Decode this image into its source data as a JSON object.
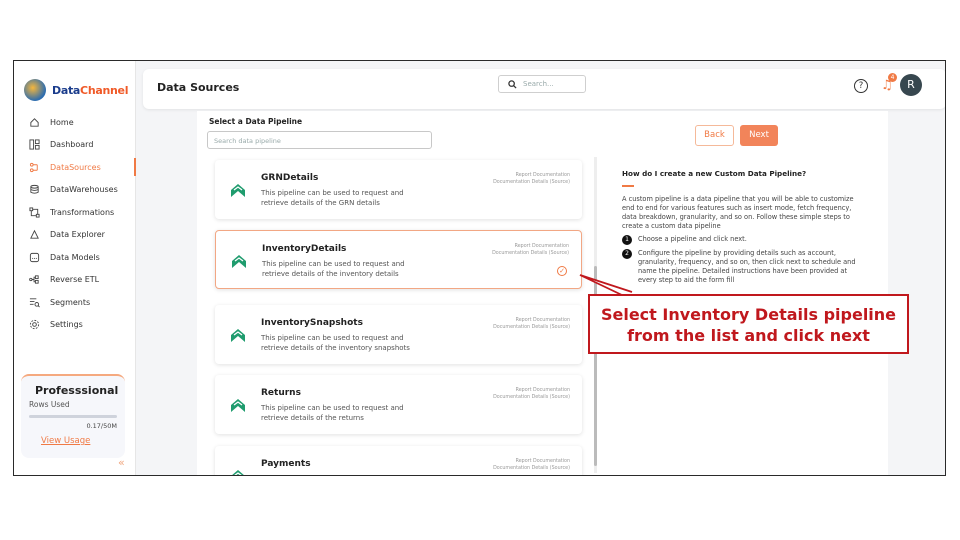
{
  "app": {
    "brand_part1": "Data",
    "brand_part2": "Channel"
  },
  "header": {
    "title": "Data Sources",
    "search_placeholder": "Search...",
    "help": "?",
    "notifications": "4",
    "avatar": "R"
  },
  "sidebar": {
    "items": [
      {
        "label": "Home",
        "icon": "home-icon"
      },
      {
        "label": "Dashboard",
        "icon": "dashboard-icon"
      },
      {
        "label": "DataSources",
        "icon": "datasources-icon",
        "active": true
      },
      {
        "label": "DataWarehouses",
        "icon": "database-icon"
      },
      {
        "label": "Transformations",
        "icon": "transform-icon"
      },
      {
        "label": "Data Explorer",
        "icon": "explorer-icon"
      },
      {
        "label": "Data Models",
        "icon": "models-icon"
      },
      {
        "label": "Reverse ETL",
        "icon": "reverse-etl-icon"
      },
      {
        "label": "Segments",
        "icon": "segments-icon"
      },
      {
        "label": "Settings",
        "icon": "settings-icon"
      }
    ],
    "plan": {
      "title": "Professsional",
      "rows_label": "Rows Used",
      "rows_value": "0.17/50M",
      "usage_link": "View Usage",
      "usage_fraction": 0.0034
    }
  },
  "main": {
    "select_label": "Select a Data Pipeline",
    "search_placeholder": "Search data pipeline",
    "back": "Back",
    "next": "Next",
    "pipelines": [
      {
        "name": "GRNDetails",
        "desc": "This pipeline can be used to request and retrieve details of the GRN details",
        "doc1": "Report Documentation",
        "doc2": "Documentation Details (Source)"
      },
      {
        "name": "InventoryDetails",
        "desc": "This pipeline can be used to request and retrieve details of the inventory details",
        "doc1": "Report Documentation",
        "doc2": "Documentation Details (Source)",
        "selected": true
      },
      {
        "name": "InventorySnapshots",
        "desc": "This pipeline can be used to request and retrieve details of the inventory snapshots",
        "doc1": "Report Documentation",
        "doc2": "Documentation Details (Source)"
      },
      {
        "name": "Returns",
        "desc": "This pipeline can be used to request and retrieve details of the returns",
        "doc1": "Report Documentation",
        "doc2": "Documentation Details (Source)"
      },
      {
        "name": "Payments",
        "desc": "",
        "doc1": "Report Documentation",
        "doc2": "Documentation Details (Source)"
      }
    ],
    "help": {
      "title": "How do I create a new Custom Data Pipeline?",
      "text": "A custom pipeline is a data pipeline that you will be able to customize end to end for various features such as insert mode, fetch frequency, data breakdown, granularity, and so on. Follow these simple steps to create a custom data pipeline",
      "steps": [
        {
          "num": "1",
          "text": "Choose a pipeline and click next."
        },
        {
          "num": "2",
          "text": "Configure the pipeline by providing details such as account, granularity, frequency, and so on, then click next to schedule and name the pipeline. Detailed instructions have been provided at every step to aid the form fill"
        }
      ]
    }
  },
  "callout": {
    "text": "Select Inventory Details pipeline from the list and click next"
  },
  "colors": {
    "accent": "#f07a45",
    "callout": "#c0181d"
  }
}
